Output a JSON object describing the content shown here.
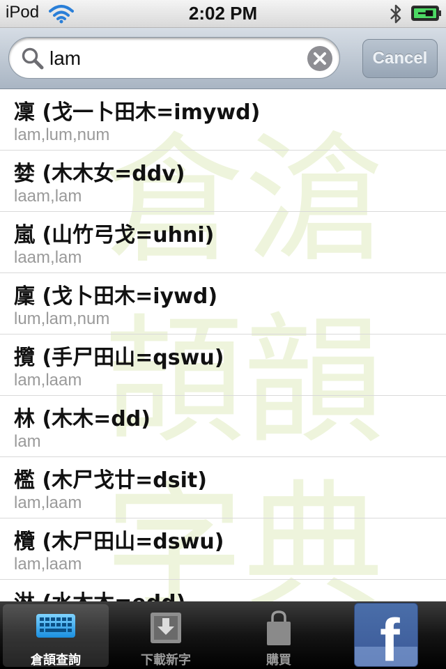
{
  "status_bar": {
    "carrier": "iPod",
    "time": "2:02 PM",
    "wifi_icon": "wifi-icon",
    "bluetooth_icon": "bluetooth-icon",
    "battery_icon": "battery-charging-icon"
  },
  "search": {
    "value": "lam",
    "placeholder": "",
    "cancel_label": "Cancel"
  },
  "results": [
    {
      "title": "凜 (戈一卜田木=imywd)",
      "readings": "lam,lum,num"
    },
    {
      "title": "婪 (木木女=ddv)",
      "readings": "laam,lam"
    },
    {
      "title": "嵐 (山竹弓戈=uhni)",
      "readings": "laam,lam"
    },
    {
      "title": "廩 (戈卜田木=iywd)",
      "readings": "lum,lam,num"
    },
    {
      "title": "攬 (手尸田山=qswu)",
      "readings": "lam,laam"
    },
    {
      "title": "林 (木木=dd)",
      "readings": "lam"
    },
    {
      "title": "檻 (木尸戈廿=dsit)",
      "readings": "lam,laam"
    },
    {
      "title": "欖 (木尸田山=dswu)",
      "readings": "lam,laam"
    },
    {
      "title": "淋 (水木木=edd)",
      "readings": ""
    }
  ],
  "tabs": [
    {
      "label": "倉頡查詢",
      "icon": "keyboard-icon",
      "selected": true
    },
    {
      "label": "下載新字",
      "icon": "download-icon",
      "selected": false
    },
    {
      "label": "購買",
      "icon": "shopping-bag-icon",
      "selected": false
    }
  ],
  "facebook": {
    "icon": "facebook-icon",
    "logo_text": "f"
  },
  "colors": {
    "search_bar": "#a9b5c3",
    "subtitle_text": "#9a9a9a",
    "facebook_blue": "#3b5998",
    "battery_green": "#4cd964"
  }
}
